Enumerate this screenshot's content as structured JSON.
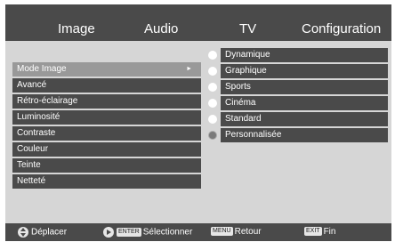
{
  "tabs": [
    "Image",
    "Audio",
    "TV",
    "Configuration"
  ],
  "menu": [
    {
      "label": "Mode Image",
      "selected": true
    },
    {
      "label": "Avancé"
    },
    {
      "label": "Rétro-éclairage"
    },
    {
      "label": "Luminosité"
    },
    {
      "label": "Contraste"
    },
    {
      "label": "Couleur"
    },
    {
      "label": "Teinte"
    },
    {
      "label": "Netteté"
    }
  ],
  "options": [
    {
      "label": "Dynamique"
    },
    {
      "label": "Graphique"
    },
    {
      "label": "Sports"
    },
    {
      "label": "Cinéma"
    },
    {
      "label": "Standard"
    },
    {
      "label": "Personnalisée",
      "current": true
    }
  ],
  "hints": {
    "move": "Déplacer",
    "enter_key": "ENTER",
    "select": "Sélectionner",
    "menu_key": "MENU",
    "back": "Retour",
    "exit_key": "EXIT",
    "end": "Fin"
  },
  "colors": {
    "bar": "#4a4a4a",
    "panel": "#d6d6d6",
    "selected": "#999999"
  }
}
